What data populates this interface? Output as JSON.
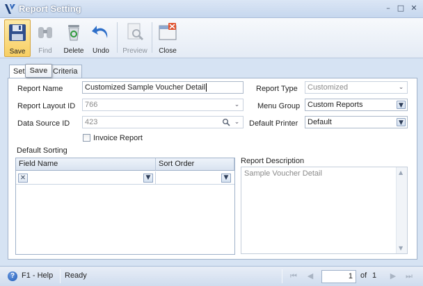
{
  "window": {
    "title": "Report Setting",
    "minimize": "–",
    "maximize": "□",
    "close": "✕"
  },
  "toolbar": {
    "save": "Save",
    "find": "Find",
    "delete": "Delete",
    "undo": "Undo",
    "preview": "Preview",
    "close": "Close"
  },
  "tooltip": "Save",
  "tabs": {
    "setting": "Set",
    "criteria": "Criteria"
  },
  "form": {
    "report_name_label": "Report Name",
    "report_name_value": "Customized Sample Voucher Detail",
    "report_type_label": "Report Type",
    "report_type_value": "Customized",
    "report_layout_label": "Report Layout ID",
    "report_layout_value": "766",
    "menu_group_label": "Menu Group",
    "menu_group_value": "Custom Reports",
    "data_source_label": "Data Source ID",
    "data_source_value": "423",
    "default_printer_label": "Default Printer",
    "default_printer_value": "Default",
    "invoice_report_label": "Invoice Report",
    "invoice_report_checked": false,
    "default_sorting_label": "Default Sorting",
    "report_description_label": "Report Description",
    "report_description_value": "Sample Voucher Detail"
  },
  "sorting_grid": {
    "columns": [
      "Field Name",
      "Sort Order"
    ]
  },
  "status": {
    "help": "F1 - Help",
    "state": "Ready",
    "page_current": "1",
    "of_label": "of",
    "page_total": "1"
  },
  "colors": {
    "accent": "#f8cf63",
    "border": "#9fb1c9",
    "chrome": "#d6e3f3"
  }
}
